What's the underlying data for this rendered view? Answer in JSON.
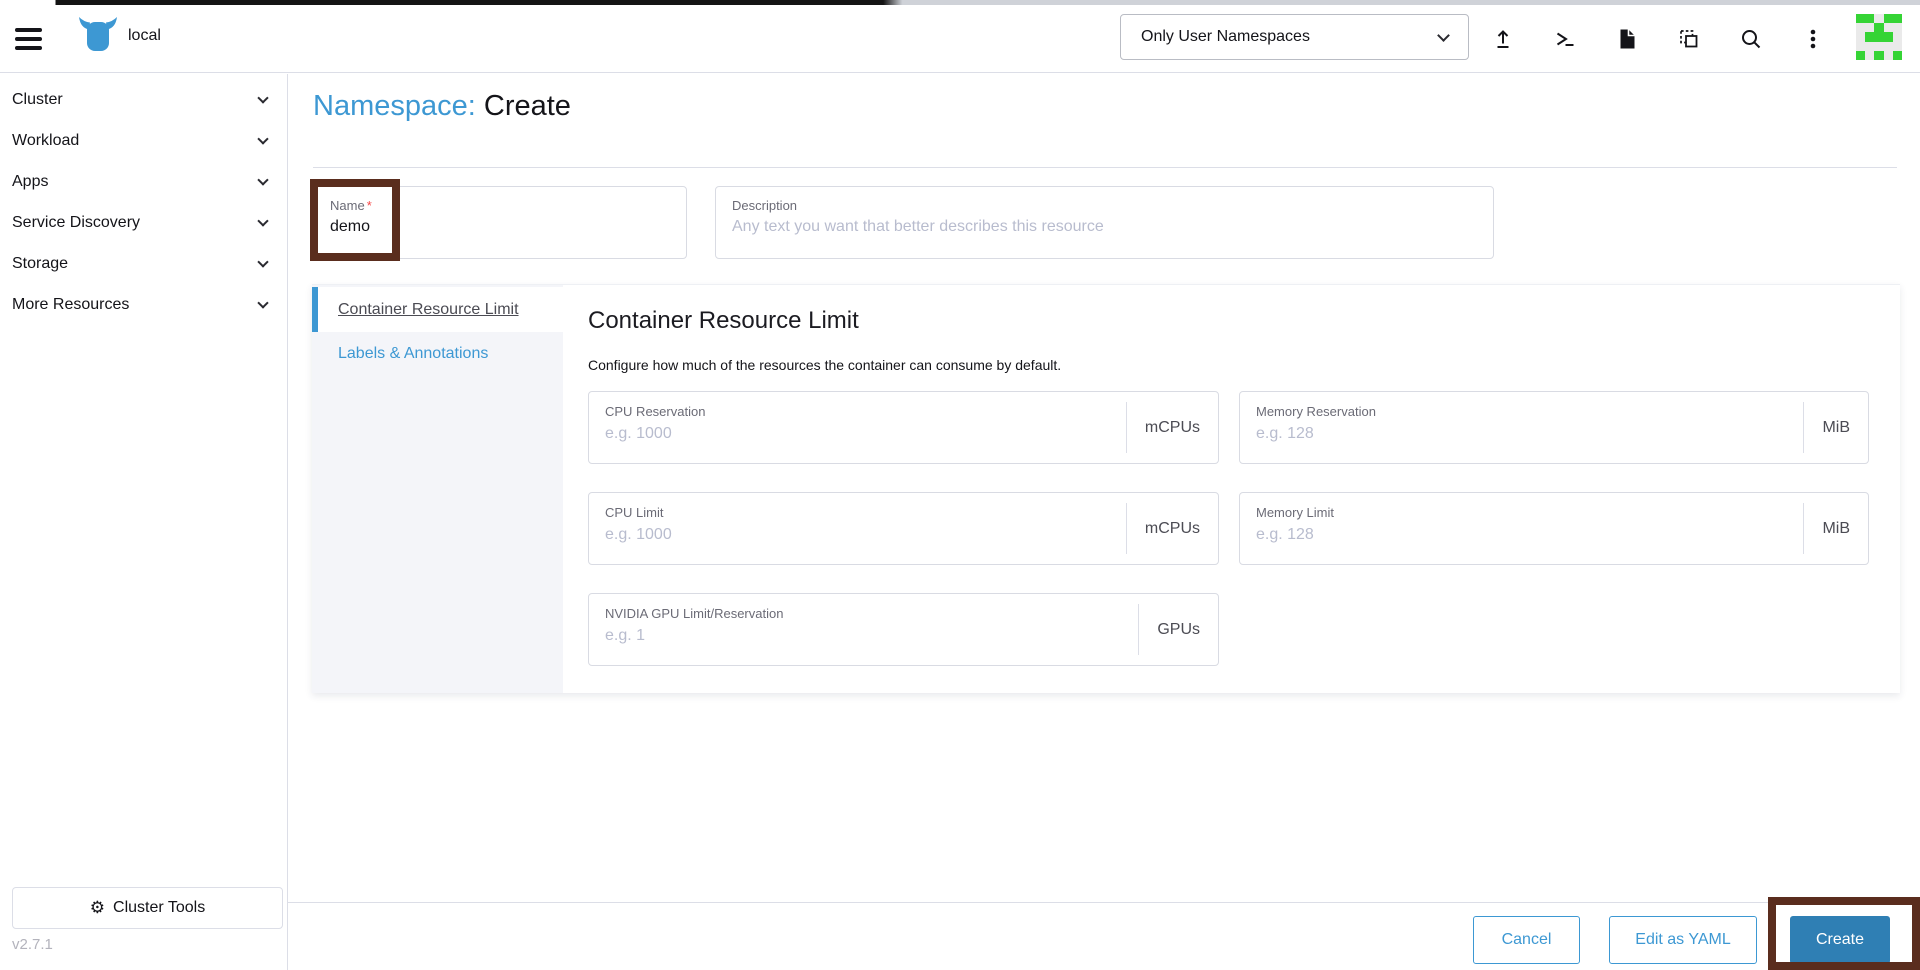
{
  "header": {
    "cluster_name": "local",
    "namespace_filter": {
      "value": "Only User Namespaces"
    },
    "avatar": {
      "pattern": [
        "11011",
        "00100",
        "01110",
        "00000",
        "10101"
      ],
      "green": "#35d435",
      "bg": "#eaeaea"
    }
  },
  "sidebar": {
    "items": [
      {
        "label": "Cluster"
      },
      {
        "label": "Workload"
      },
      {
        "label": "Apps"
      },
      {
        "label": "Service Discovery"
      },
      {
        "label": "Storage"
      },
      {
        "label": "More Resources"
      }
    ],
    "cluster_tools_label": "Cluster Tools",
    "version": "v2.7.1"
  },
  "page": {
    "title_prefix": "Namespace:",
    "title_action": "Create",
    "name_field": {
      "label": "Name",
      "required_mark": "*",
      "value": "demo"
    },
    "description_field": {
      "label": "Description",
      "placeholder": "Any text you want that better describes this resource"
    },
    "tabs": [
      {
        "label": "Container Resource Limit"
      },
      {
        "label": "Labels & Annotations"
      }
    ],
    "section": {
      "heading": "Container Resource Limit",
      "description": "Configure how much of the resources the container can consume by default.",
      "fields": [
        {
          "label": "CPU Reservation",
          "placeholder": "e.g. 1000",
          "unit": "mCPUs"
        },
        {
          "label": "Memory Reservation",
          "placeholder": "e.g. 128",
          "unit": "MiB"
        },
        {
          "label": "CPU Limit",
          "placeholder": "e.g. 1000",
          "unit": "mCPUs"
        },
        {
          "label": "Memory Limit",
          "placeholder": "e.g. 128",
          "unit": "MiB"
        },
        {
          "label": "NVIDIA GPU Limit/Reservation",
          "placeholder": "e.g. 1",
          "unit": "GPUs"
        }
      ]
    },
    "footer": {
      "cancel_label": "Cancel",
      "edit_yaml_label": "Edit as YAML",
      "create_label": "Create"
    }
  },
  "colors": {
    "accent": "#3d98d3",
    "primary_button": "#2f7fb4",
    "annotation_box": "#5a2d1e",
    "border": "#dcdee7",
    "text": "#141419",
    "label": "#6b6b76",
    "placeholder": "#b8bcce"
  }
}
